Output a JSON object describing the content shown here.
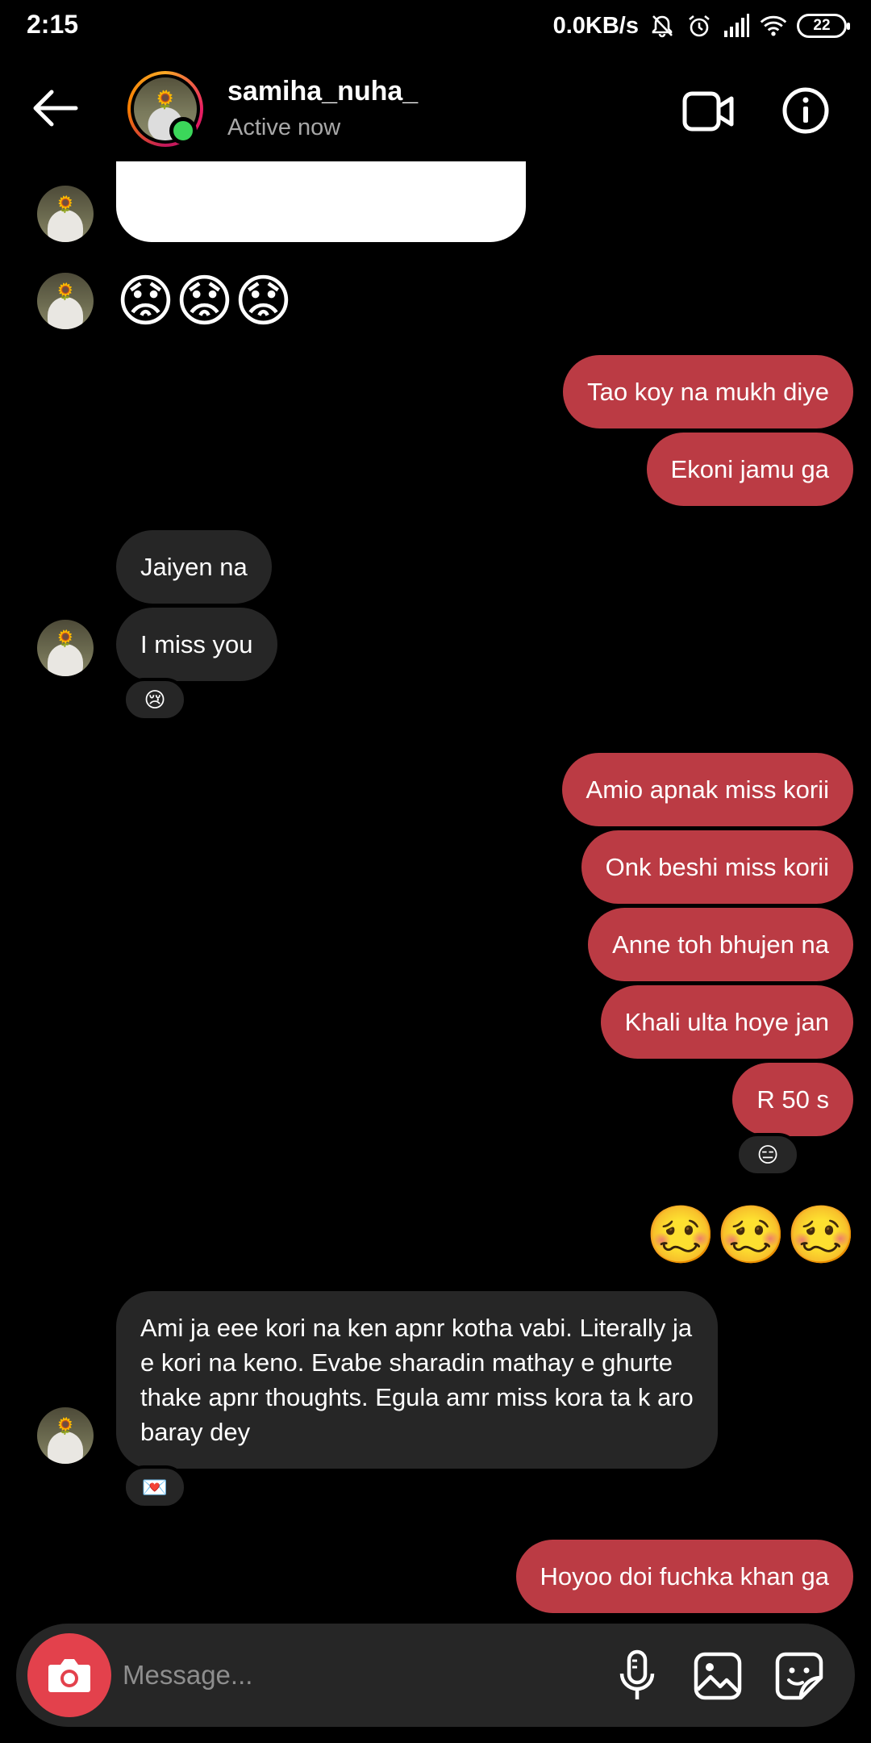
{
  "status_bar": {
    "time": "2:15",
    "network_speed": "0.0KB/s",
    "battery": "22"
  },
  "header": {
    "username": "samiha_nuha_",
    "status": "Active now"
  },
  "messages": {
    "emoji_in_1": "😟😟😟",
    "out_1": "Tao koy na mukh diye",
    "out_2": "Ekoni jamu ga",
    "in_1": "Jaiyen na",
    "in_2": "I miss you",
    "react_in_2": "😢",
    "out_3": "Amio apnak miss korii",
    "out_4": "Onk beshi miss korii",
    "out_5": "Anne toh bhujen na",
    "out_6": "Khali ulta hoye jan",
    "out_7": "R 50 s",
    "react_out_7": "😑",
    "emoji_out_1": "🥴🥴🥴",
    "in_3": "Ami ja eee kori na ken apnr kotha vabi. Literally ja e kori na keno. Evabe sharadin mathay e ghurte thake apnr thoughts. Egula amr miss kora ta k aro baray dey",
    "react_in_3": "💌",
    "out_8": "Hoyoo doi fuchka khan ga"
  },
  "composer": {
    "placeholder": "Message..."
  },
  "colors": {
    "outgoing_bubble": "#bb3b44",
    "incoming_bubble": "#262626",
    "online": "#3bd75a",
    "camera": "#e3414c"
  },
  "icons": [
    "back-arrow-icon",
    "video-call-icon",
    "info-icon",
    "camera-icon",
    "microphone-icon",
    "gallery-icon",
    "sticker-icon",
    "mute-icon",
    "alarm-icon",
    "signal-icon",
    "wifi-icon"
  ]
}
